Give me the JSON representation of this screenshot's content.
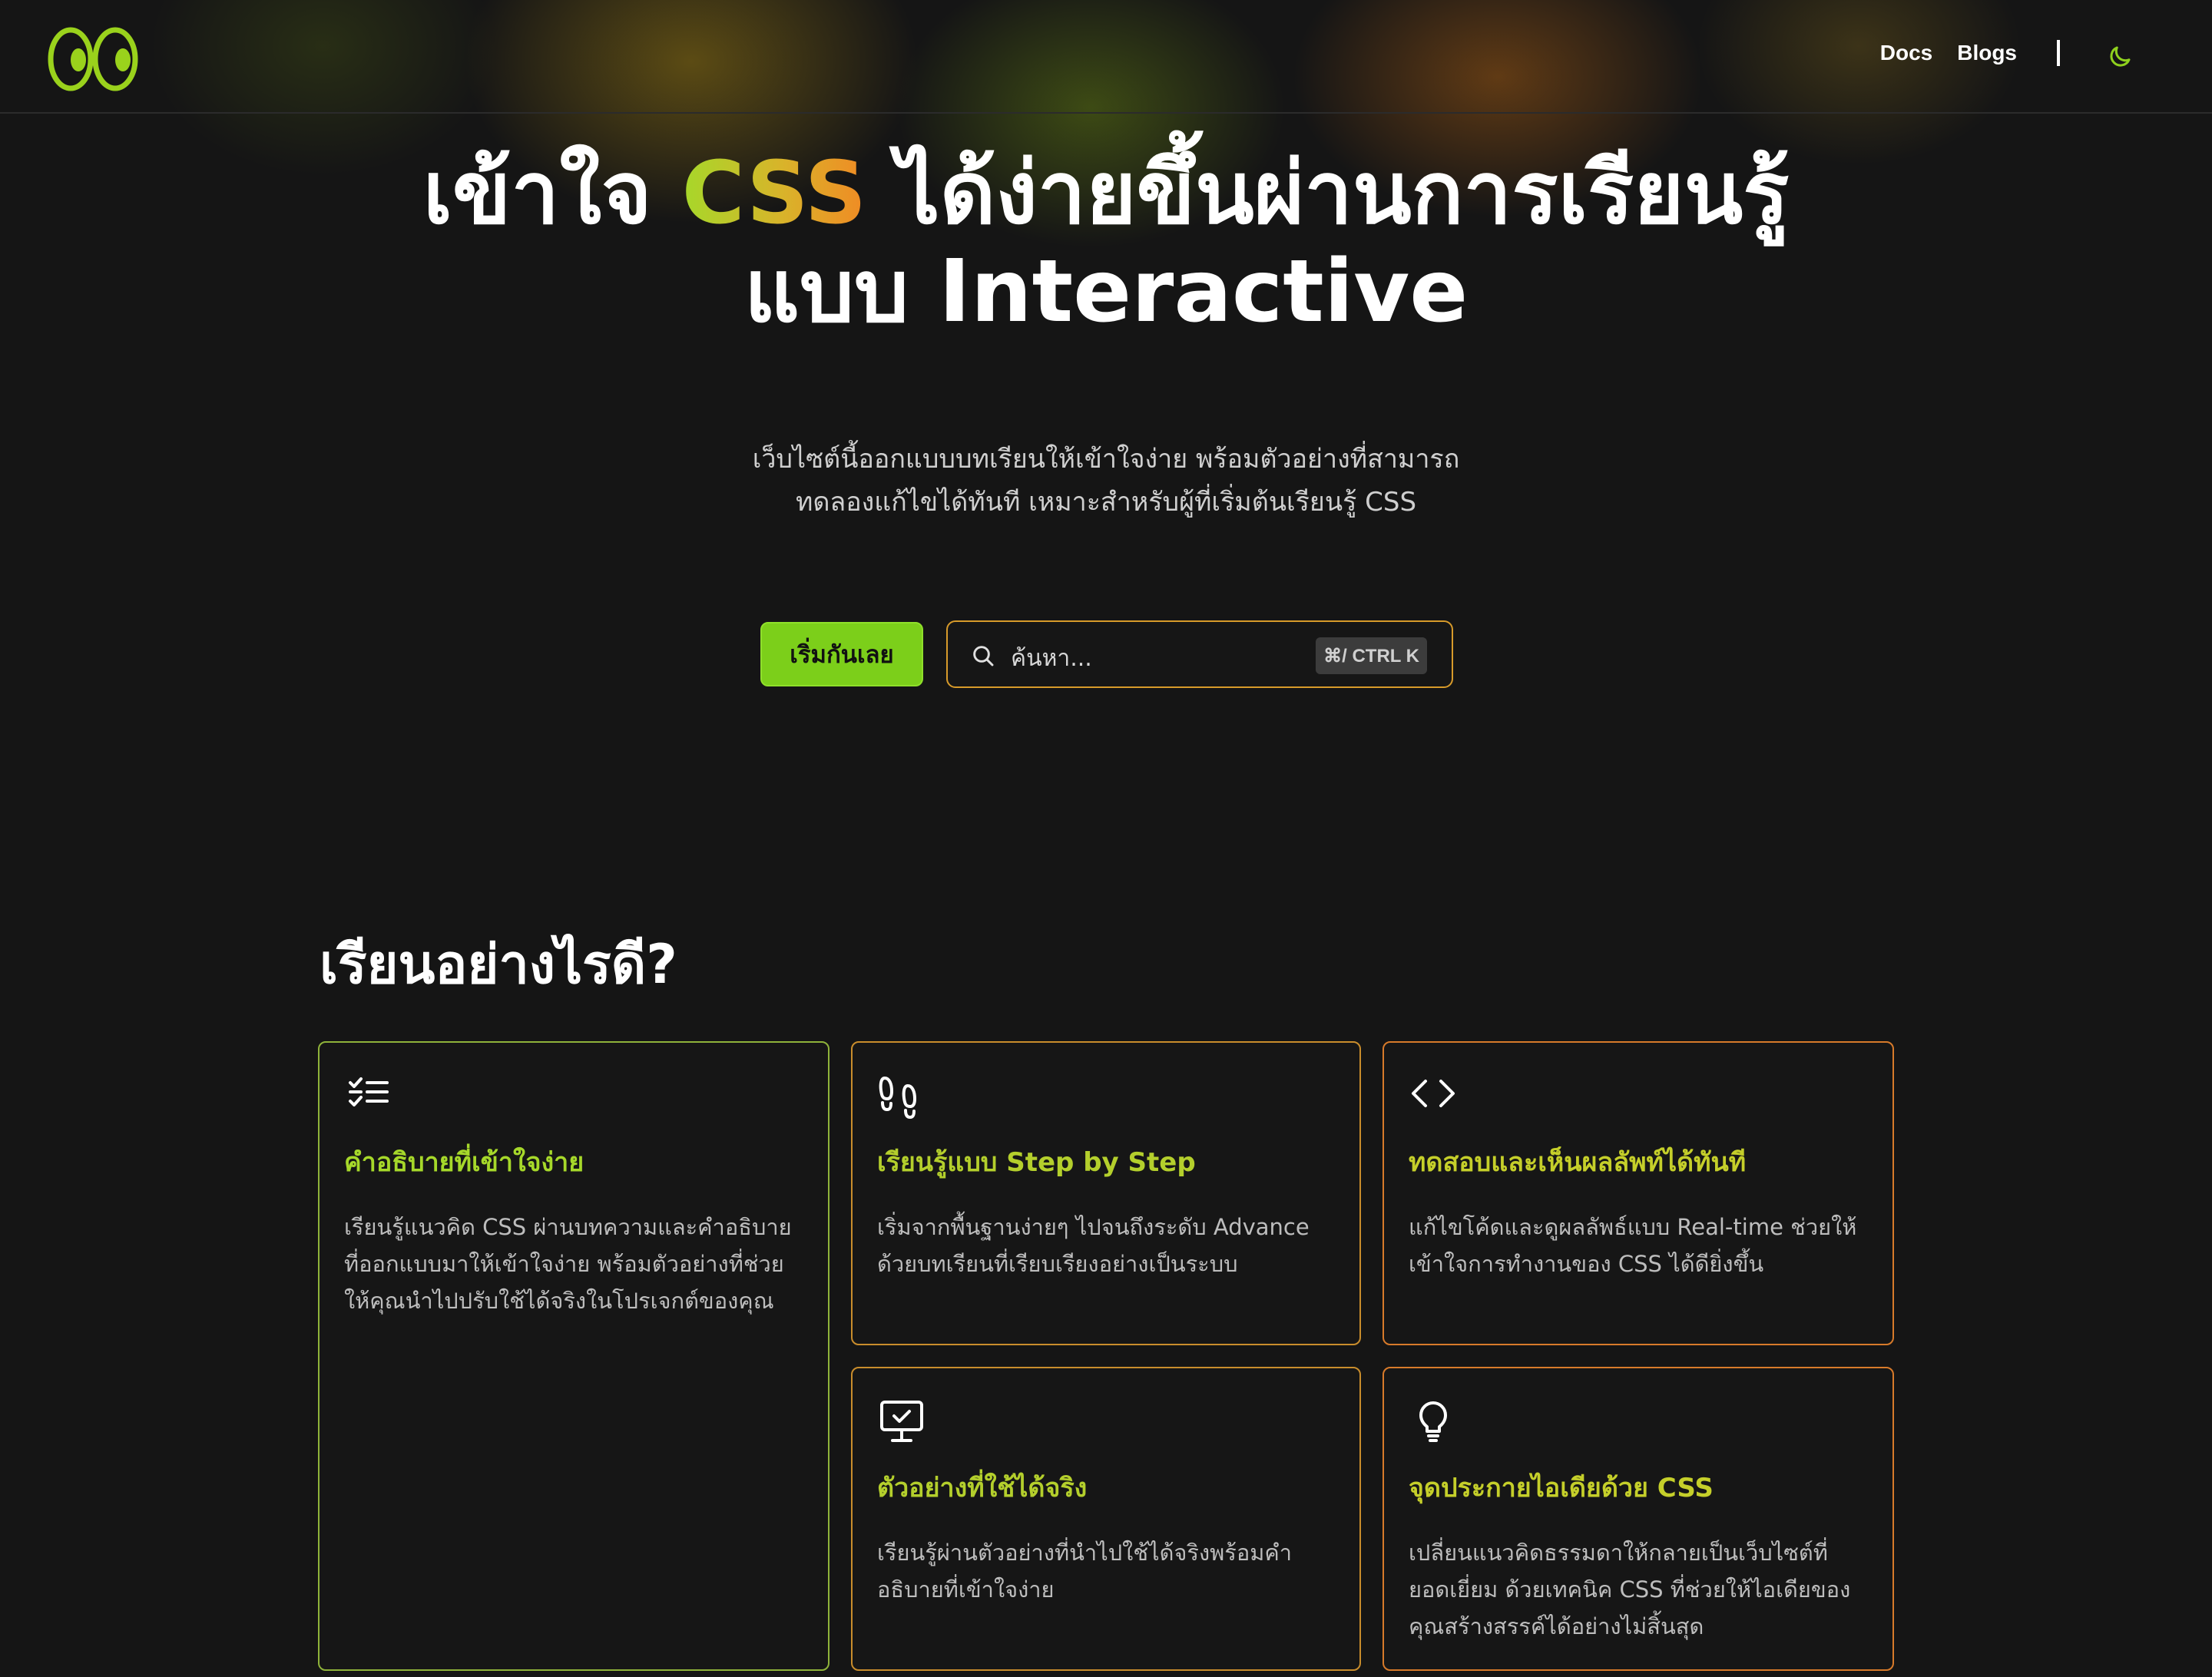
{
  "header": {
    "logo": "eyes-logo",
    "nav": [
      "Docs",
      "Blogs"
    ],
    "theme_toggle_icon": "moon-icon"
  },
  "hero": {
    "title_part1": "เข้าใจ ",
    "title_css": "CSS",
    "title_part2": " ได้ง่ายขึ้นผ่านการเรียนรู้",
    "title_line2": "แบบ Interactive",
    "subtitle_line1": "เว็บไซต์นี้ออกแบบบทเรียนให้เข้าใจง่าย พร้อมตัวอย่างที่สามารถ",
    "subtitle_line2": "ทดลองแก้ไขได้ทันที เหมาะสำหรับผู้ที่เริ่มต้นเรียนรู้ CSS",
    "cta_label": "เริ่มกันเลย",
    "search_placeholder": "ค้นหา...",
    "search_shortcut": "⌘/ CTRL K"
  },
  "section": {
    "title": "เรียนอย่างไรดี?",
    "cards": [
      {
        "icon": "checklist-icon",
        "title": "คำอธิบายที่เข้าใจง่าย",
        "desc": "เรียนรู้แนวคิด CSS ผ่านบทความและคำอธิบายที่ออกแบบมาให้เข้าใจง่าย พร้อมตัวอย่างที่ช่วยให้คุณนำไปปรับใช้ได้จริงในโปรเจกต์ของคุณ"
      },
      {
        "icon": "footprints-icon",
        "title": "เรียนรู้แบบ Step by Step",
        "desc": "เริ่มจากพื้นฐานง่ายๆ ไปจนถึงระดับ Advance ด้วยบทเรียนที่เรียบเรียงอย่างเป็นระบบ"
      },
      {
        "icon": "code-brackets-icon",
        "title": "ทดสอบและเห็นผลลัพท์ได้ทันที",
        "desc": "แก้ไขโค้ดและดูผลลัพธ์แบบ Real-time ช่วยให้เข้าใจการทำงานของ CSS ได้ดียิ่งขึ้น"
      },
      {
        "icon": "monitor-check-icon",
        "title": "ตัวอย่างที่ใช้ได้จริง",
        "desc": "เรียนรู้ผ่านตัวอย่างที่นำไปใช้ได้จริงพร้อมคำอธิบายที่เข้าใจง่าย"
      },
      {
        "icon": "lightbulb-icon",
        "title": "จุดประกายไอเดียด้วย CSS",
        "desc": "เปลี่ยนแนวคิดธรรมดาให้กลายเป็นเว็บไซต์ที่ยอดเยี่ยม ด้วยเทคนิค CSS ที่ช่วยให้ไอเดียของคุณสร้างสรรค์ได้อย่างไม่สิ้นสุด"
      }
    ]
  }
}
